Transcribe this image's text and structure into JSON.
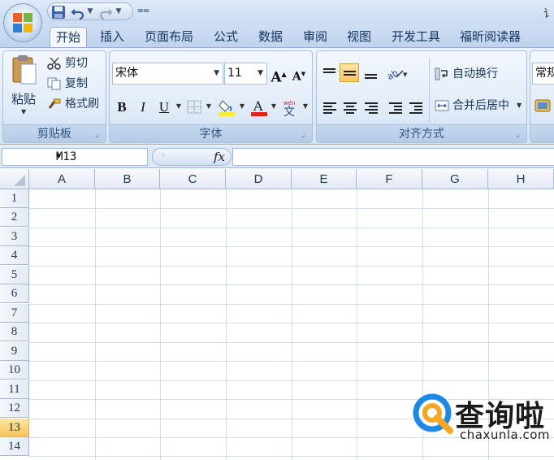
{
  "window": {
    "title": "讠"
  },
  "tabs": [
    "开始",
    "插入",
    "页面布局",
    "公式",
    "数据",
    "审阅",
    "视图",
    "开发工具",
    "福昕阅读器"
  ],
  "clipboard": {
    "paste_label": "粘贴",
    "cut_label": "剪切",
    "copy_label": "复制",
    "format_painter_label": "格式刷",
    "group_label": "剪贴板"
  },
  "font": {
    "name": "宋体",
    "size": "11",
    "bold": "B",
    "italic": "I",
    "underline": "U",
    "group_label": "字体",
    "font_color": "#e0201a",
    "fill_color": "#ffeb3b"
  },
  "alignment": {
    "wrap_text_label": "自动换行",
    "merge_center_label": "合并后居中",
    "group_label": "对齐方式"
  },
  "number": {
    "format": "常规"
  },
  "formula_bar": {
    "name_box": "M13",
    "fx_label": "fx",
    "value": ""
  },
  "grid": {
    "columns": [
      "A",
      "B",
      "C",
      "D",
      "E",
      "F",
      "G",
      "H"
    ],
    "rows": [
      "1",
      "2",
      "3",
      "4",
      "5",
      "6",
      "7",
      "8",
      "9",
      "10",
      "11",
      "12",
      "13",
      "14"
    ],
    "active_row": "13"
  },
  "watermark": {
    "text": "查询啦",
    "sub": "chaxunla.com"
  }
}
